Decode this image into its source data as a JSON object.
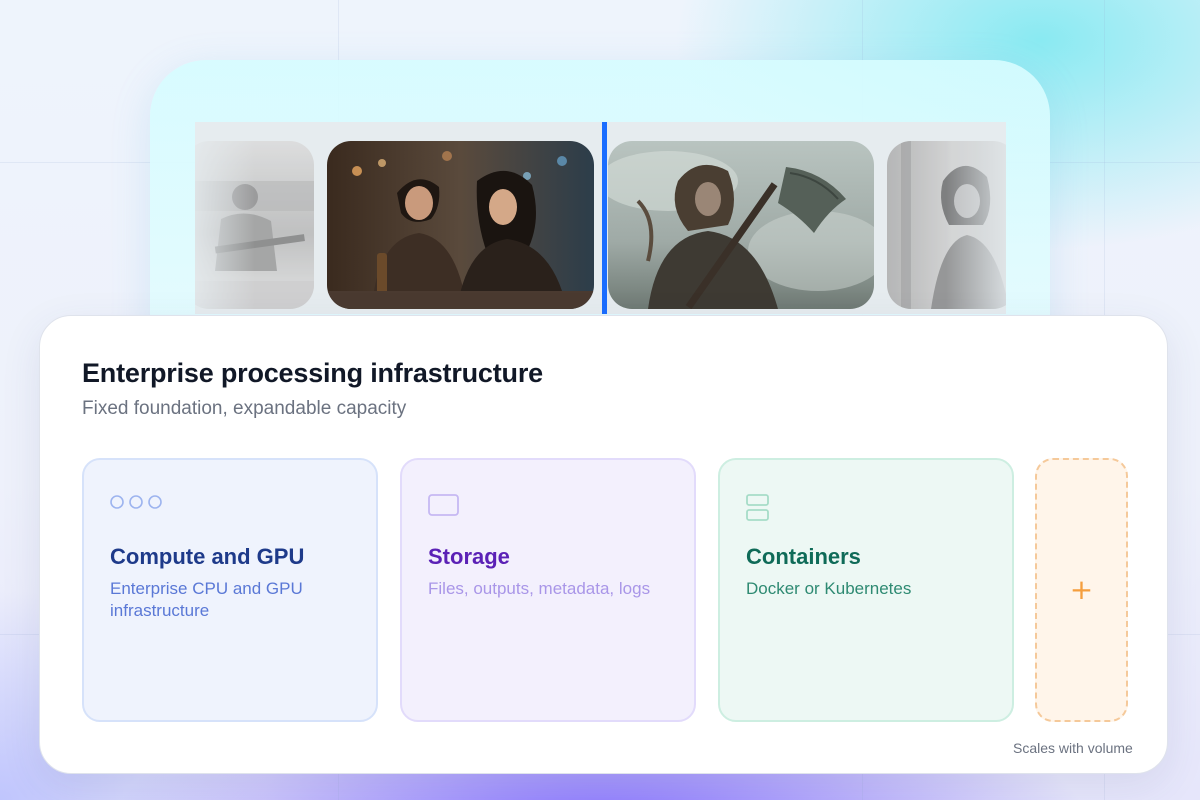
{
  "preview": {
    "images": [
      {
        "name": "rowing-athlete-photo",
        "style": "grayscale"
      },
      {
        "name": "couple-at-bar-photo",
        "style": "color"
      },
      {
        "name": "warrior-with-axe-photo",
        "style": "color"
      },
      {
        "name": "woman-portrait-photo",
        "style": "grayscale"
      }
    ],
    "divider_color": "#1a6dff"
  },
  "card": {
    "title": "Enterprise processing infrastructure",
    "subtitle": "Fixed foundation, expandable capacity",
    "tiles": [
      {
        "title": "Compute and GPU",
        "description": "Enterprise CPU and GPU infrastructure",
        "icon": "three-dots-icon",
        "accent": "#1e3a8a"
      },
      {
        "title": "Storage",
        "description": "Files, outputs, metadata, logs",
        "icon": "storage-box-icon",
        "accent": "#5b21b6"
      },
      {
        "title": "Containers",
        "description": "Docker or Kubernetes",
        "icon": "stacked-containers-icon",
        "accent": "#0f6b58"
      }
    ],
    "add_tile": {
      "glyph": "+",
      "icon": "plus-icon",
      "caption": "Scales with volume"
    }
  }
}
